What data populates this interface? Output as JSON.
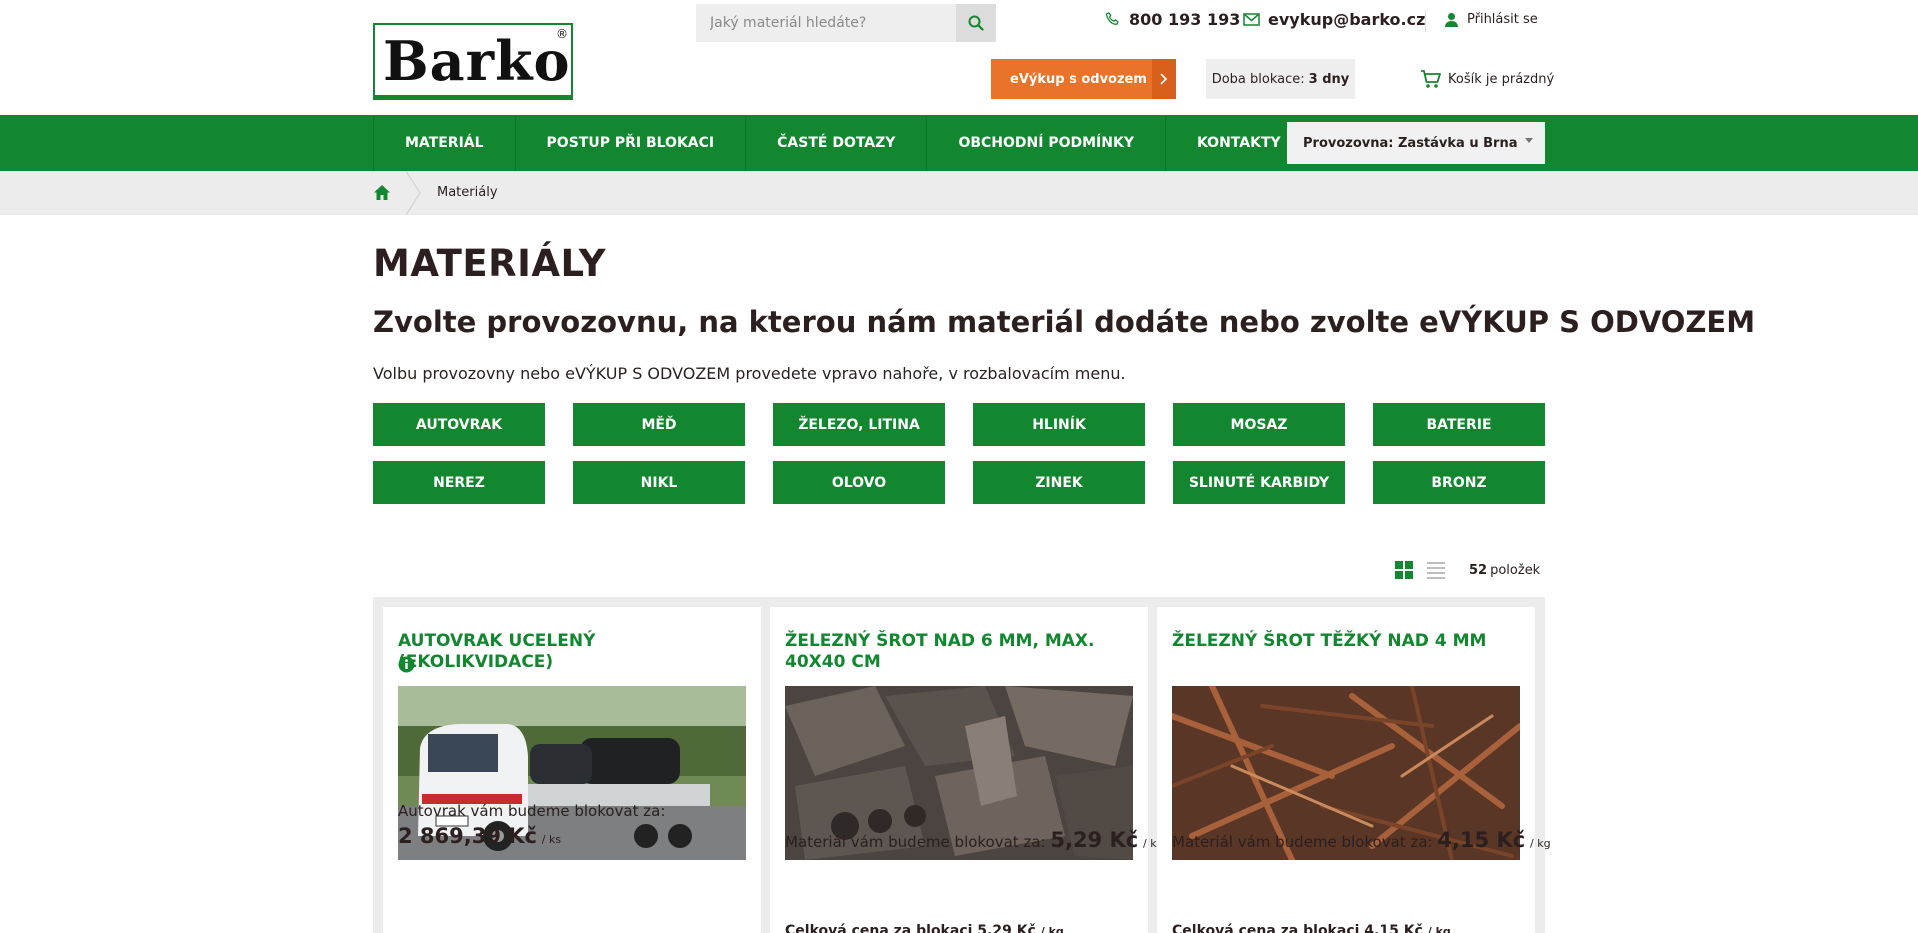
{
  "brand": {
    "logo_text": "Barko",
    "reg_mark": "®"
  },
  "search": {
    "placeholder": "Jaký materiál hledáte?"
  },
  "header": {
    "phone": "800 193 193",
    "email": "evykup@barko.cz",
    "login_label": "Přihlásit se",
    "evykup_label": "eVýkup s odvozem",
    "blokace_label": "Doba blokace:",
    "blokace_value": "3 dny",
    "cart_label": "Košík je prázdný"
  },
  "nav": {
    "items": [
      {
        "label": "MATERIÁL"
      },
      {
        "label": "POSTUP PŘI BLOKACI"
      },
      {
        "label": "ČASTÉ DOTAZY"
      },
      {
        "label": "OBCHODNÍ PODMÍNKY"
      },
      {
        "label": "KONTAKTY"
      }
    ],
    "provozovna_selected": "Provozovna: Zastávka u Brna"
  },
  "breadcrumb": {
    "current": "Materiály"
  },
  "main": {
    "title": "MATERIÁLY",
    "subtitle": "Zvolte provozovnu, na kterou nám materiál dodáte nebo zvolte eVÝKUP S ODVOZEM",
    "lead": "Volbu provozovny nebo eVÝKUP S ODVOZEM provedete vpravo nahoře, v rozbalovacím menu.",
    "categories": [
      "AUTOVRAK",
      "MĚĎ",
      "ŽELEZO, LITINA",
      "HLINÍK",
      "MOSAZ",
      "BATERIE",
      "NEREZ",
      "NIKL",
      "OLOVO",
      "ZINEK",
      "SLINUTÉ KARBIDY",
      "BRONZ"
    ],
    "count_number": "52",
    "count_label": "položek"
  },
  "products": [
    {
      "title": "AUTOVRAK UCELENÝ (EKOLIKVIDACE)",
      "price_label": "Autovrak vám budeme blokovat za:",
      "price": "2 869,39 Kč",
      "unit": "/ ks"
    },
    {
      "title": "ŽELEZNÝ ŠROT NAD 6 MM, MAX. 40X40 CM",
      "price_label": "Materiál vám budeme blokovat za:",
      "price": "5,29 Kč",
      "unit": "/ kg",
      "total_label": "Celková cena za blokaci 5,29 Kč",
      "total_unit": "/ kg"
    },
    {
      "title": "ŽELEZNÝ ŠROT TĚŽKÝ NAD 4 MM",
      "price_label": "Materiál vám budeme blokovat za:",
      "price": "4,15 Kč",
      "unit": "/ kg",
      "total_label": "Celková cena za blokaci 4,15 Kč",
      "total_unit": "/ kg"
    }
  ],
  "colors": {
    "brand_green": "#12872f",
    "accent_orange": "#e8732a"
  }
}
